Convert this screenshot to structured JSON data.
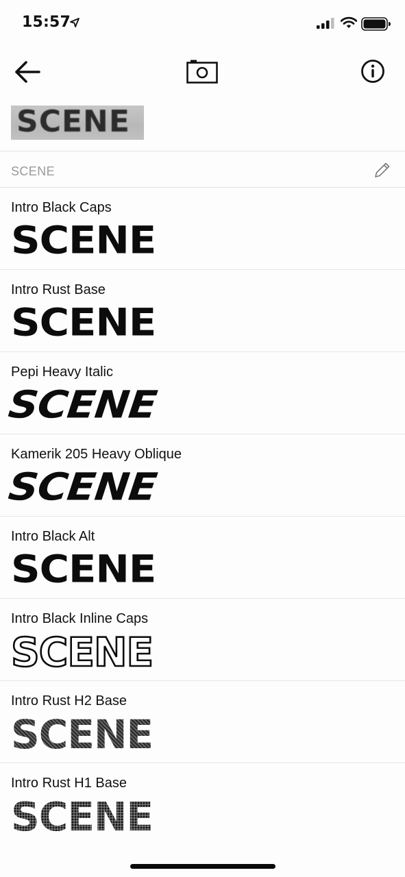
{
  "status_bar": {
    "time": "15:57",
    "icons": [
      "location-arrow-icon",
      "cellular-signal-icon",
      "wifi-icon",
      "battery-icon"
    ]
  },
  "toolbar": {
    "back_icon": "arrow-left-icon",
    "camera_icon": "camera-icon",
    "info_icon": "info-icon"
  },
  "scan_preview": {
    "text": "SCENE"
  },
  "query": {
    "text": "SCENE",
    "edit_icon": "pencil-icon"
  },
  "results": [
    {
      "name": "Intro Black Caps",
      "sample": "SCENE",
      "style": "caps"
    },
    {
      "name": "Intro Rust Base",
      "sample": "SCENE",
      "style": "caps"
    },
    {
      "name": "Pepi Heavy Italic",
      "sample": "SCENE",
      "style": "italic"
    },
    {
      "name": "Kamerik 205 Heavy Oblique",
      "sample": "SCENE",
      "style": "italic"
    },
    {
      "name": "Intro Black Alt",
      "sample": "SCENE",
      "style": "caps"
    },
    {
      "name": "Intro Black Inline Caps",
      "sample": "SCENE",
      "style": "inline"
    },
    {
      "name": "Intro Rust H2 Base",
      "sample": "SCENE",
      "style": "textured"
    },
    {
      "name": "Intro Rust H1 Base",
      "sample": "SCENE",
      "style": "dotted"
    }
  ]
}
